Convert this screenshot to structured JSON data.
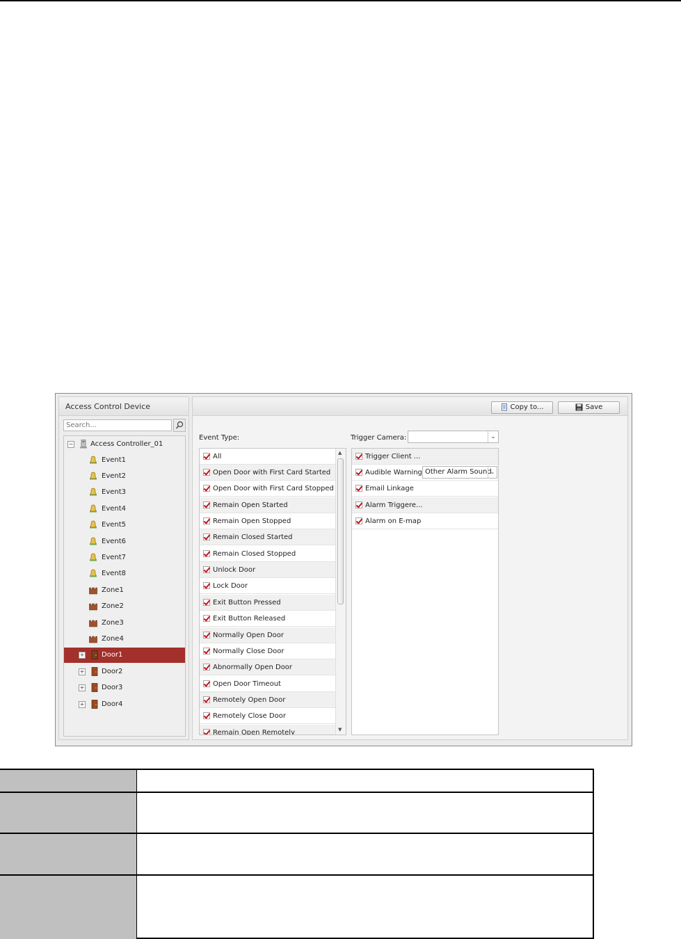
{
  "left_panel": {
    "title": "Access Control Device",
    "search_placeholder": "Search...",
    "tree": {
      "root": "Access Controller_01",
      "events": [
        "Event1",
        "Event2",
        "Event3",
        "Event4",
        "Event5",
        "Event6",
        "Event7",
        "Event8"
      ],
      "zones": [
        "Zone1",
        "Zone2",
        "Zone3",
        "Zone4"
      ],
      "doors": [
        "Door1",
        "Door2",
        "Door3",
        "Door4"
      ],
      "selected": "Door1"
    }
  },
  "toolbar": {
    "copy_label": "Copy to...",
    "save_label": "Save"
  },
  "event_type": {
    "label": "Event Type:",
    "items": [
      "All",
      "Open Door with First Card Started",
      "Open Door with First Card Stopped",
      "Remain Open Started",
      "Remain Open Stopped",
      "Remain Closed Started",
      "Remain Closed Stopped",
      "Unlock Door",
      "Lock Door",
      "Exit Button Pressed",
      "Exit Button Released",
      "Normally Open Door",
      "Normally Close Door",
      "Abnormally Open Door",
      "Open Door Timeout",
      "Remotely Open Door",
      "Remotely Close Door",
      "Remain Open Remotely"
    ]
  },
  "trigger_camera": {
    "label": "Trigger Camera:",
    "value": ""
  },
  "linkage": {
    "items": [
      "Trigger Client ...",
      "Audible Warning",
      "Email Linkage",
      "Alarm Triggere...",
      "Alarm on E-map"
    ],
    "sound_value": "Other Alarm Sound"
  },
  "colors": {
    "selected_row": "#a3302a",
    "check_mark": "#c0161b"
  }
}
